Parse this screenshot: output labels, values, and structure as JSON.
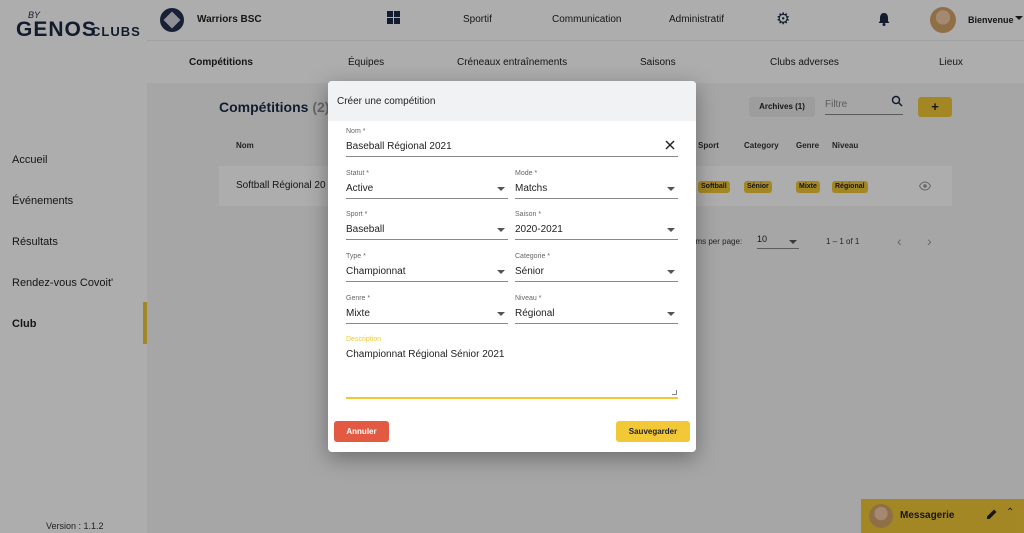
{
  "app": {
    "logo_top": "BY",
    "logo_main": "GENOS",
    "logo_sub": "CLUBS",
    "version": "Version : 1.1.2"
  },
  "sidebar": {
    "items": [
      {
        "label": "Accueil"
      },
      {
        "label": "Événements"
      },
      {
        "label": "Résultats"
      },
      {
        "label": "Rendez-vous Covoit'"
      },
      {
        "label": "Club"
      }
    ],
    "active": "Club"
  },
  "topbar": {
    "club_name": "Warriors BSC",
    "links": [
      "Sportif",
      "Communication",
      "Administratif"
    ],
    "welcome": "Bienvenue"
  },
  "subnav": {
    "items": [
      "Compétitions",
      "Équipes",
      "Créneaux entraînements",
      "Saisons",
      "Clubs adverses",
      "Lieux"
    ],
    "active": "Compétitions"
  },
  "page": {
    "title": "Compétitions",
    "count": "(2)",
    "archives_label": "Archives (1)",
    "filter_placeholder": "Filtre",
    "add_label": "+",
    "columns": {
      "name": "Nom",
      "sport": "Sport",
      "category": "Category",
      "genre": "Genre",
      "niveau": "Niveau"
    },
    "rows": [
      {
        "name": "Softball Régional 20",
        "sport": "Softball",
        "category": "Sénior",
        "genre": "Mixte",
        "niveau": "Régional"
      }
    ],
    "pager": {
      "label": "ems per page:",
      "size": "10",
      "range": "1 – 1 of 1"
    }
  },
  "dialog": {
    "title": "Créer une compétition",
    "fields": {
      "nom": {
        "label": "Nom *",
        "value": "Baseball Régional 2021"
      },
      "statut": {
        "label": "Statut *",
        "value": "Active"
      },
      "mode": {
        "label": "Mode *",
        "value": "Matchs"
      },
      "sport": {
        "label": "Sport *",
        "value": "Baseball"
      },
      "saison": {
        "label": "Saison *",
        "value": "2020-2021"
      },
      "type": {
        "label": "Type *",
        "value": "Championnat"
      },
      "categorie": {
        "label": "Categorie *",
        "value": "Sénior"
      },
      "genre": {
        "label": "Genre *",
        "value": "Mixte"
      },
      "niveau": {
        "label": "Niveau *",
        "value": "Régional"
      },
      "description": {
        "label": "Description",
        "value": "Championnat Régional Sénior 2021"
      }
    },
    "cancel_label": "Annuler",
    "save_label": "Sauvegarder"
  },
  "messenger": {
    "title": "Messagerie"
  },
  "colors": {
    "accent": "#f2c837",
    "danger": "#e35a43",
    "navy": "#1d2a44"
  }
}
